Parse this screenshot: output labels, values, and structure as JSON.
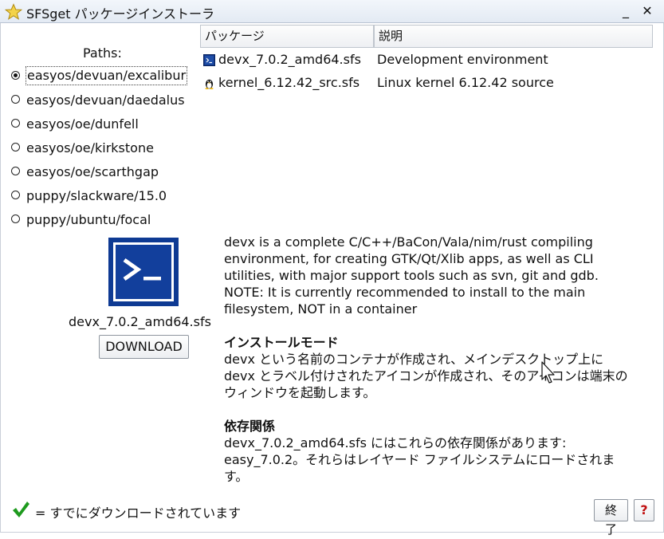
{
  "window": {
    "title": "SFSget パッケージインストーラ",
    "app_icon": "star-icon",
    "minimize_glyph": "_",
    "close_glyph": "✕"
  },
  "paths": {
    "label": "Paths:",
    "items": [
      {
        "label": "easyos/devuan/excalibur",
        "selected": true
      },
      {
        "label": "easyos/devuan/daedalus",
        "selected": false
      },
      {
        "label": "easyos/oe/dunfell",
        "selected": false
      },
      {
        "label": "easyos/oe/kirkstone",
        "selected": false
      },
      {
        "label": "easyos/oe/scarthgap",
        "selected": false
      },
      {
        "label": "puppy/slackware/15.0",
        "selected": false
      },
      {
        "label": "puppy/ubuntu/focal",
        "selected": false
      }
    ]
  },
  "table": {
    "headers": [
      "パッケージ",
      "説明"
    ],
    "rows": [
      {
        "name": "devx_7.0.2_amd64.sfs",
        "description": "Development environment",
        "icon": "terminal-icon"
      },
      {
        "name": "kernel_6.12.42_src.sfs",
        "description": "Linux kernel 6.12.42 source",
        "icon": "tux-icon"
      }
    ]
  },
  "selected_package": {
    "icon": "terminal-icon",
    "filename": "devx_7.0.2_amd64.sfs",
    "download_label": "DOWNLOAD",
    "description_lines": [
      "devx is a complete C/C++/BaCon/Vala/nim/rust compiling",
      "environment, for creating GTK/Qt/Xlib apps, as well as CLI",
      "utilities, with major support tools such as svn, git and gdb.",
      "NOTE: It is currently recommended to install to the main",
      "filesystem, NOT in a container"
    ],
    "install_mode_heading": "インストールモード",
    "install_mode_lines": [
      "devx という名前のコンテナが作成され、メインデスクトップ上に",
      "devx とラベル付けされたアイコンが作成され、そのアイコンは端末の",
      "ウィンドウを起動します。"
    ],
    "dependencies_heading": "依存関係",
    "dependencies_lines": [
      "devx_7.0.2_amd64.sfs にはこれらの依存関係があります:",
      "easy_7.0.2。それらはレイヤード ファイルシステムにロードされま",
      "す。"
    ]
  },
  "footer": {
    "status_icon": "checkmark-icon",
    "status_color": "#1e9a1e",
    "status_text": "= すでにダウンロードされています",
    "quit_label": "終了",
    "help_label": "?",
    "help_color": "#c01010"
  }
}
